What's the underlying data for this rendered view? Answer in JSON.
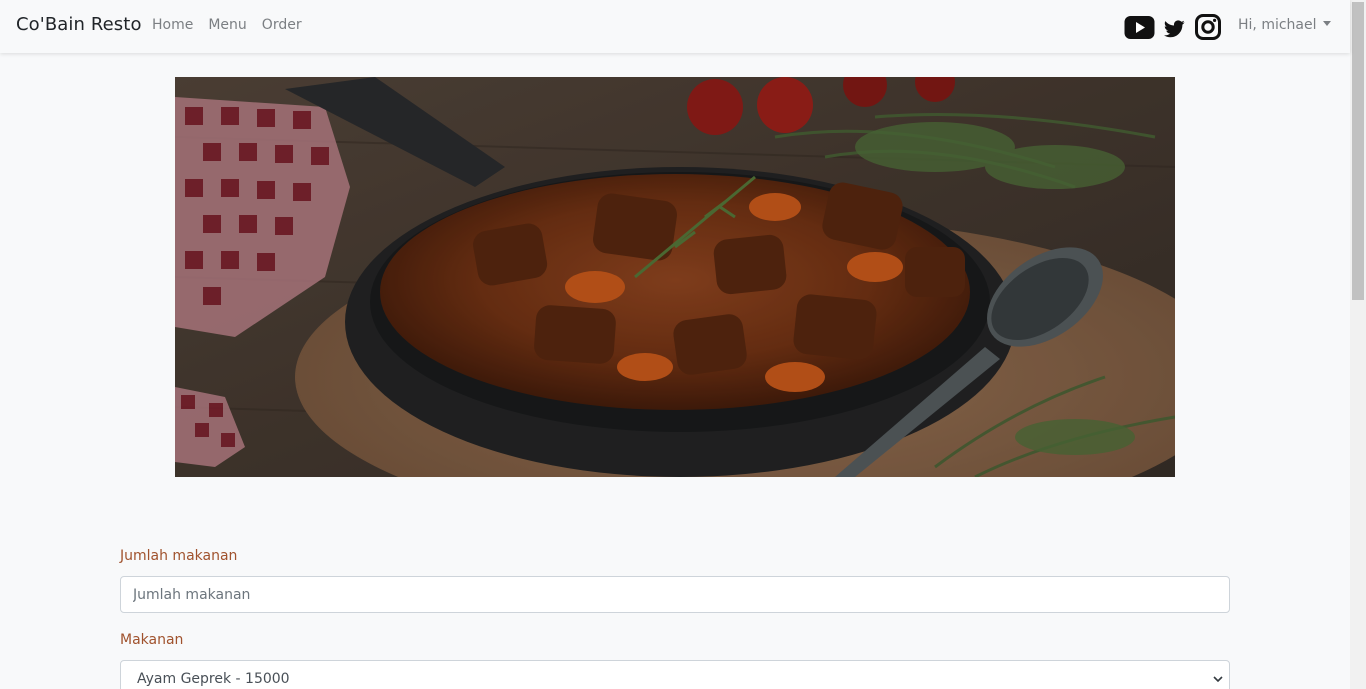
{
  "navbar": {
    "brand": "Co'Bain Resto",
    "links": [
      "Home",
      "Menu",
      "Order"
    ],
    "social_icons": [
      "youtube-icon",
      "twitter-icon",
      "instagram-icon"
    ],
    "user_menu": "Hi, michael"
  },
  "hero": {
    "image": "beef-stew-skillet-photo"
  },
  "form": {
    "quantity_label": "Jumlah makanan",
    "quantity_placeholder": "Jumlah makanan",
    "food_label": "Makanan",
    "food_selected": "Ayam Geprek - 15000"
  },
  "colors": {
    "label": "#a0522d",
    "background": "#f8f9fa",
    "nav_text": "#7b7f83"
  }
}
